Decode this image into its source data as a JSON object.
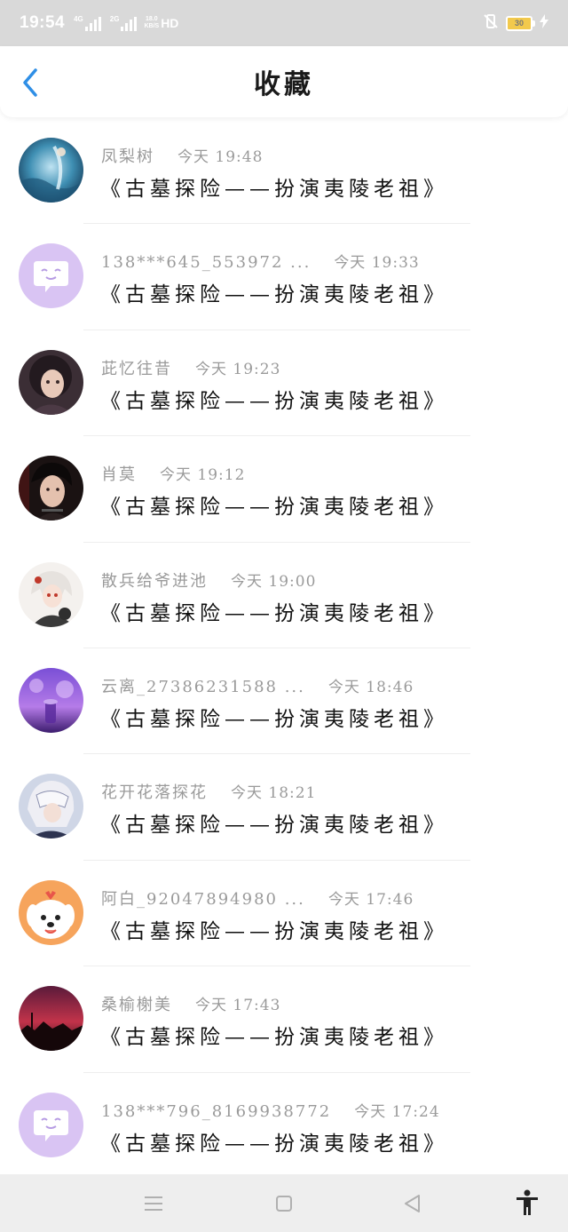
{
  "status_bar": {
    "time": "19:54",
    "sim1_label": "4G",
    "sim2_label": "2G",
    "net_speed_value": "18.0",
    "net_speed_unit": "KB/S",
    "hd_label": "HD",
    "battery_level": "30"
  },
  "header": {
    "title": "收藏",
    "back_icon": "chevron-left-icon",
    "accent_color": "#2f8fe6"
  },
  "favorites": [
    {
      "author": "凤梨树",
      "time": "今天 19:48",
      "title": "《古墓探险——扮演夷陵老祖》",
      "avatar": "ocean-mermaid-avatar"
    },
    {
      "author": "138***645_553972 ...",
      "time": "今天 19:33",
      "title": "《古墓探险——扮演夷陵老祖》",
      "avatar": "default-chat-avatar"
    },
    {
      "author": "茈忆往昔",
      "time": "今天 19:23",
      "title": "《古墓探险——扮演夷陵老祖》",
      "avatar": "dark-hair-girl-avatar"
    },
    {
      "author": "肖莫",
      "time": "今天 19:12",
      "title": "《古墓探险——扮演夷陵老祖》",
      "avatar": "black-hair-man-avatar"
    },
    {
      "author": "散兵给爷进池",
      "time": "今天 19:00",
      "title": "《古墓探险——扮演夷陵老祖》",
      "avatar": "white-hair-character-avatar"
    },
    {
      "author": "云离_27386231588 ...",
      "time": "今天 18:46",
      "title": "《古墓探险——扮演夷陵老祖》",
      "avatar": "purple-sky-avatar"
    },
    {
      "author": "花开花落探花",
      "time": "今天 18:21",
      "title": "《古墓探险——扮演夷陵老祖》",
      "avatar": "masked-character-avatar"
    },
    {
      "author": "阿白_92047894980 ...",
      "time": "今天 17:46",
      "title": "《古墓探险——扮演夷陵老祖》",
      "avatar": "cute-dog-avatar"
    },
    {
      "author": "桑榆榭美",
      "time": "今天 17:43",
      "title": "《古墓探险——扮演夷陵老祖》",
      "avatar": "sunset-avatar"
    },
    {
      "author": "138***796_8169938772",
      "time": "今天 17:24",
      "title": "《古墓探险——扮演夷陵老祖》",
      "avatar": "default-chat-avatar"
    }
  ],
  "bottom_nav": {
    "menu_icon": "menu-icon",
    "home_icon": "home-square-icon",
    "back_icon": "back-triangle-icon",
    "accessibility_icon": "accessibility-icon"
  }
}
